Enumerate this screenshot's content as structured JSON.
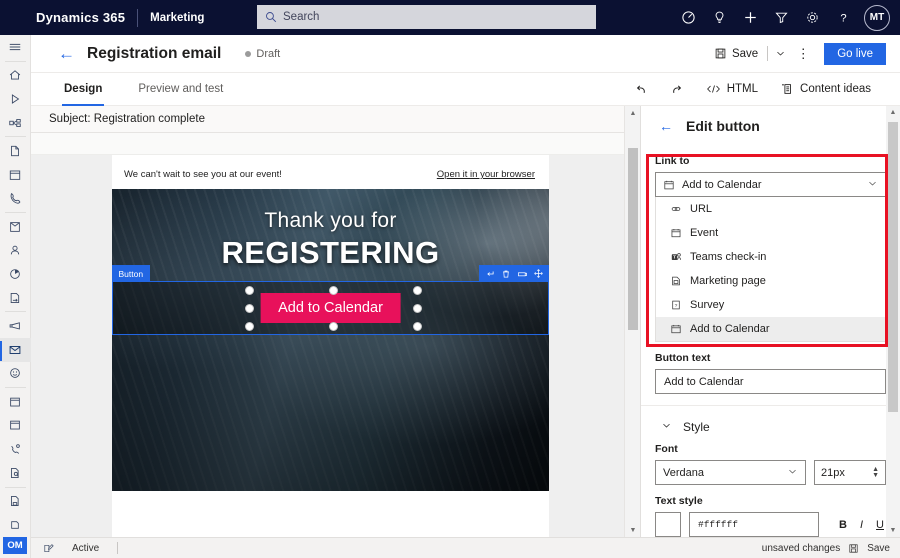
{
  "topnav": {
    "brand": "Dynamics 365",
    "app_name": "Marketing",
    "search_placeholder": "Search",
    "icons": [
      "assistant-icon",
      "lightbulb-icon",
      "add-icon",
      "filter-icon",
      "gear-icon",
      "help-icon"
    ],
    "avatar_initials": "MT"
  },
  "rail": {
    "items": [
      {
        "name": "hamburger-menu-icon"
      },
      {
        "name": "home-icon"
      },
      {
        "name": "recent-icon"
      },
      {
        "name": "pinned-icon"
      },
      {
        "name": "documents-icon"
      },
      {
        "name": "calendar-icon"
      },
      {
        "name": "phone-icon"
      },
      {
        "name": "accounts-icon"
      },
      {
        "name": "contacts-icon"
      },
      {
        "name": "segments-icon"
      },
      {
        "name": "customer-journey-icon"
      },
      {
        "name": "marketing-campaign-icon"
      },
      {
        "name": "marketing-email-icon"
      },
      {
        "name": "customer-voice-icon"
      },
      {
        "name": "events-icon"
      },
      {
        "name": "event-calendar-icon"
      },
      {
        "name": "voice-settings-icon"
      },
      {
        "name": "lead-scoring-icon"
      },
      {
        "name": "template-icon"
      },
      {
        "name": "content-icon"
      }
    ],
    "badge": "OM"
  },
  "commandbar": {
    "page_title": "Registration email",
    "status": "Draft",
    "save_label": "Save",
    "golive_label": "Go live",
    "more_label": "⋮"
  },
  "tabs": {
    "items": [
      {
        "label": "Design",
        "active": true
      },
      {
        "label": "Preview and test",
        "active": false
      }
    ],
    "html_label": "HTML",
    "content_ideas_label": "Content ideas"
  },
  "canvas": {
    "subject": "Subject: Registration complete",
    "preheader": "We can't wait to see you at our event!",
    "browser_link": "Open it in your browser",
    "hero_line1": "Thank you for",
    "hero_line2": "REGISTERING",
    "selection_tag": "Button",
    "selection_toolbar": [
      "revert-icon",
      "delete-icon",
      "duplicate-icon",
      "move-icon"
    ],
    "cta_label": "Add to Calendar"
  },
  "panel": {
    "title": "Edit button",
    "link_to_label": "Link to",
    "link_to_value": "Add to Calendar",
    "options": [
      {
        "label": "URL",
        "icon": "link-icon"
      },
      {
        "label": "Event",
        "icon": "calendar-icon"
      },
      {
        "label": "Teams check-in",
        "icon": "teams-icon"
      },
      {
        "label": "Marketing page",
        "icon": "page-icon"
      },
      {
        "label": "Survey",
        "icon": "survey-icon"
      },
      {
        "label": "Add to Calendar",
        "icon": "calendar-icon"
      }
    ],
    "selected_option_index": 5,
    "button_text_label": "Button text",
    "button_text_value": "Add to Calendar",
    "style_label": "Style",
    "font_label": "Font",
    "font_value": "Verdana",
    "font_size_value": "21px",
    "text_style_label": "Text style",
    "text_color_value": "#ffffff",
    "bold_label": "B",
    "italic_label": "I",
    "underline_label": "U"
  },
  "statusbar": {
    "state": "Active",
    "unsaved": "unsaved changes",
    "save_label": "Save"
  },
  "colors": {
    "nav_bg": "#0b1132",
    "accent_blue": "#2266e3",
    "cta_pink": "#e8115b",
    "annotation_red": "#e81123"
  }
}
